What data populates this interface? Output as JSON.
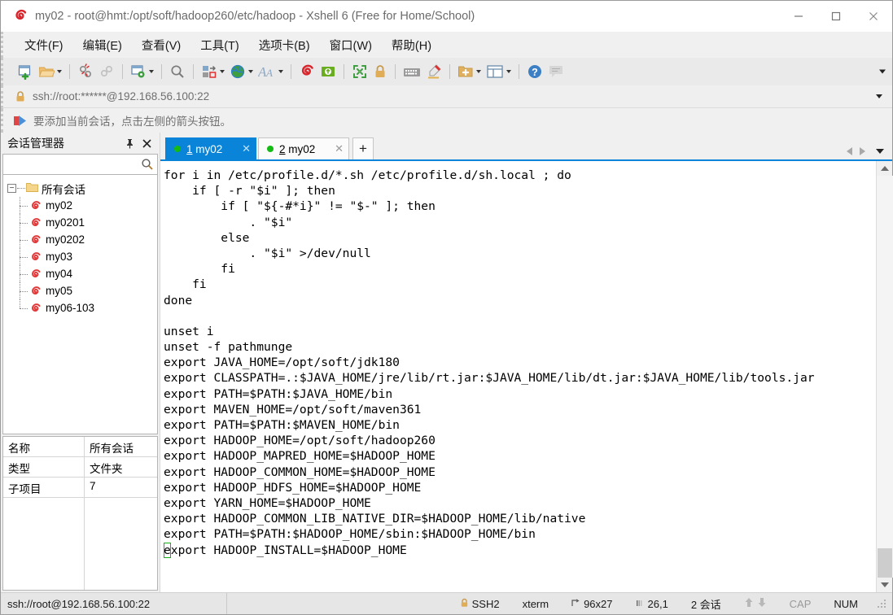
{
  "window": {
    "app_icon": "xshell-logo-icon",
    "title": "my02 - root@hmt:/opt/soft/hadoop260/etc/hadoop - Xshell 6 (Free for Home/School)",
    "minimize_label": "—",
    "maximize_label": "□",
    "close_label": "✕"
  },
  "menubar": {
    "items": [
      {
        "label": "文件(F)",
        "name": "menu-file"
      },
      {
        "label": "编辑(E)",
        "name": "menu-edit"
      },
      {
        "label": "查看(V)",
        "name": "menu-view"
      },
      {
        "label": "工具(T)",
        "name": "menu-tools"
      },
      {
        "label": "选项卡(B)",
        "name": "menu-tabs"
      },
      {
        "label": "窗口(W)",
        "name": "menu-window"
      },
      {
        "label": "帮助(H)",
        "name": "menu-help"
      }
    ]
  },
  "toolbar": {
    "icons": [
      "new-session-icon",
      "open-folder-icon",
      "disconnect-icon",
      "reconnect-icon",
      "session-properties-icon",
      "find-icon",
      "transfer-icon",
      "globe-icon",
      "font-icon",
      "xshell-icon",
      "xftp-icon",
      "fullscreen-icon",
      "lock-icon",
      "keyboard-icon",
      "highlight-icon",
      "new-folder-icon",
      "layout-icon",
      "help-icon",
      "chat-icon"
    ],
    "overflow_label": "▾"
  },
  "address": {
    "lock_icon": "lock-icon",
    "value": "ssh://root:******@192.168.56.100:22",
    "placeholder": "ssh://",
    "dropdown_label": "▾"
  },
  "notice": {
    "icon": "add-session-arrow-icon",
    "text": "要添加当前会话，点击左侧的箭头按钮。"
  },
  "sidebar": {
    "title": "会话管理器",
    "pin_label": "⚑",
    "close_label": "✕",
    "search": {
      "value": "",
      "placeholder": ""
    },
    "tree": {
      "root_label": "所有会话",
      "root_toggle": "−",
      "children": [
        {
          "label": "my02"
        },
        {
          "label": "my0201"
        },
        {
          "label": "my0202"
        },
        {
          "label": "my03"
        },
        {
          "label": "my04"
        },
        {
          "label": "my05"
        },
        {
          "label": "my06-103"
        }
      ]
    },
    "properties": [
      {
        "key": "名称",
        "value": "所有会话"
      },
      {
        "key": "类型",
        "value": "文件夹"
      },
      {
        "key": "子项目",
        "value": "7"
      }
    ]
  },
  "tabs": {
    "items": [
      {
        "num": "1",
        "label": "my02",
        "active": true,
        "close_label": "✕",
        "dot_color": "#15bb15"
      },
      {
        "num": "2",
        "label": "my02",
        "active": false,
        "close_label": "✕",
        "dot_color": "#15bb15"
      }
    ],
    "add_label": "+",
    "nav_prev": "◂",
    "nav_next": "▸",
    "nav_list": "▾"
  },
  "terminal": {
    "lines": [
      "for i in /etc/profile.d/*.sh /etc/profile.d/sh.local ; do",
      "    if [ -r \"$i\" ]; then",
      "        if [ \"${-#*i}\" != \"$-\" ]; then",
      "            . \"$i\"",
      "        else",
      "            . \"$i\" >/dev/null",
      "        fi",
      "    fi",
      "done",
      "",
      "unset i",
      "unset -f pathmunge",
      "export JAVA_HOME=/opt/soft/jdk180",
      "export CLASSPATH=.:$JAVA_HOME/jre/lib/rt.jar:$JAVA_HOME/lib/dt.jar:$JAVA_HOME/lib/tools.jar",
      "export PATH=$PATH:$JAVA_HOME/bin",
      "export MAVEN_HOME=/opt/soft/maven361",
      "export PATH=$PATH:$MAVEN_HOME/bin",
      "export HADOOP_HOME=/opt/soft/hadoop260",
      "export HADOOP_MAPRED_HOME=$HADOOP_HOME",
      "export HADOOP_COMMON_HOME=$HADOOP_HOME",
      "export HADOOP_HDFS_HOME=$HADOOP_HOME",
      "export YARN_HOME=$HADOOP_HOME",
      "export HADOOP_COMMON_LIB_NATIVE_DIR=$HADOOP_HOME/lib/native",
      "export PATH=$PATH:$HADOOP_HOME/sbin:$HADOOP_HOME/bin"
    ],
    "cursor_line": "export HADOOP_INSTALL=$HADOOP_HOME",
    "cursor_char": "e",
    "cursor_rest": "xport HADOOP_INSTALL=$HADOOP_HOME",
    "cursor_color": "#18b018",
    "fg_color": "#000000",
    "bg_color": "#ffffff"
  },
  "statusbar": {
    "connection": "ssh://root@192.168.56.100:22",
    "protocol": "SSH2",
    "protocol_icon": "lock-icon",
    "term_type": "xterm",
    "size_icon": "resize-icon",
    "size": "96x27",
    "cursor_icon": "cursor-pos-icon",
    "cursor_pos": "26,1",
    "sessions": "2 会话",
    "up_arrow": "⬆",
    "down_arrow": "⬇",
    "cap": "CAP",
    "num": "NUM"
  }
}
